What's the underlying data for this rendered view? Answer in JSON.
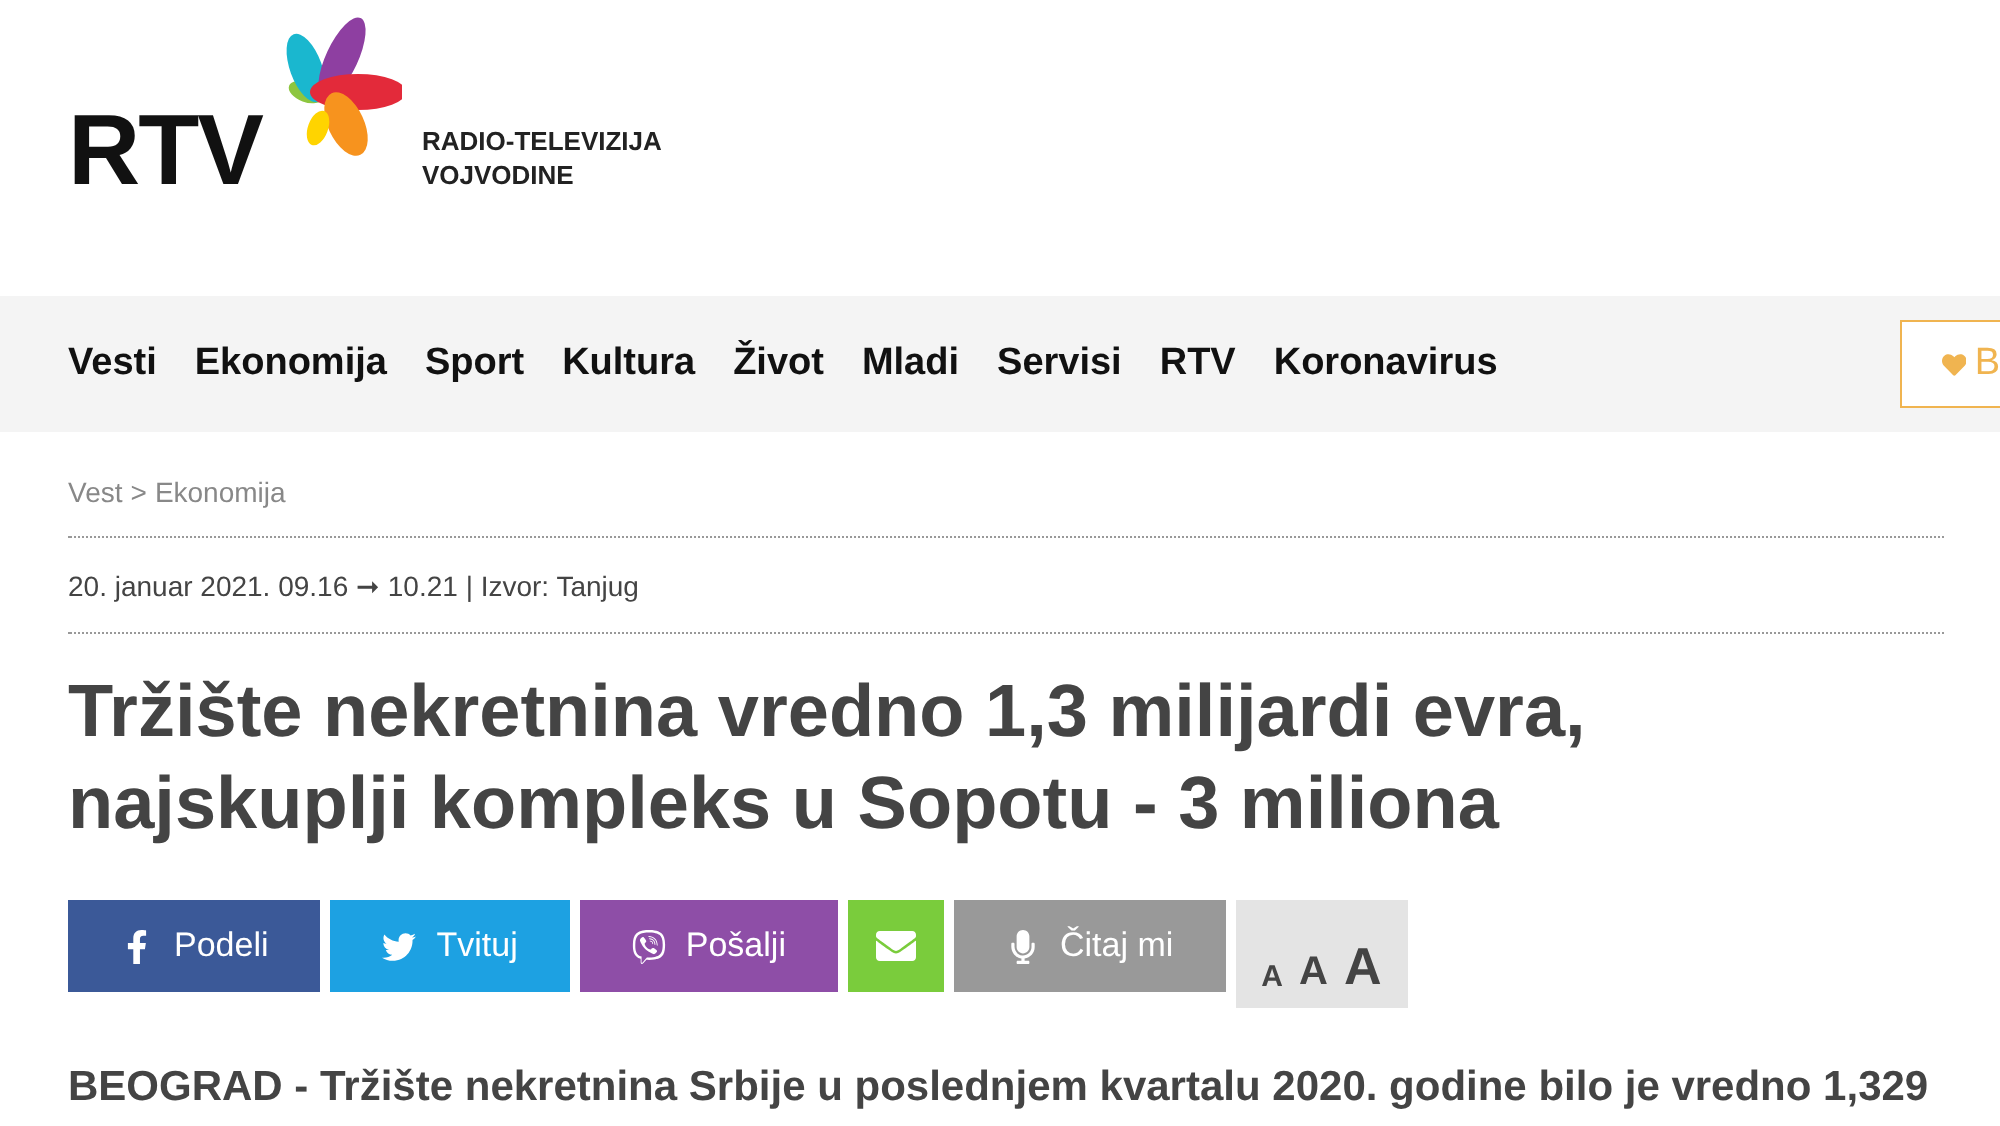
{
  "logo": {
    "letters": "RTV",
    "name_lines": [
      "RADIO-TELEVIZIJA",
      "VOJVODINE"
    ]
  },
  "nav": {
    "items": [
      "Vesti",
      "Ekonomija",
      "Sport",
      "Kultura",
      "Život",
      "Mladi",
      "Servisi",
      "RTV",
      "Koronavirus"
    ],
    "side_button": "B"
  },
  "breadcrumb": [
    {
      "label": "Vest"
    },
    {
      "label": "Ekonomija"
    }
  ],
  "breadcrumb_separator": ">",
  "meta": "20. januar 2021. 09.16 ➞ 10.21 | Izvor: Tanjug",
  "title": "Tržište nekretnina vredno 1,3 milijardi evra, najskuplji kompleks u Sopotu - 3 miliona",
  "share_buttons": [
    {
      "kind": "facebook",
      "label": "Podeli",
      "color": "#3b5998"
    },
    {
      "kind": "twitter",
      "label": "Tvituj",
      "color": "#1da1e2"
    },
    {
      "kind": "viber",
      "label": "Pošalji",
      "color": "#8e4ea7"
    },
    {
      "kind": "email",
      "color": "#7acc3c"
    },
    {
      "kind": "listen",
      "label": "Čitaj mi",
      "color": "#999999"
    }
  ],
  "font_sizes": [
    "A",
    "A",
    "A"
  ],
  "lead": "BEOGRAD - Tržište nekretnina Srbije u poslednjem kvartalu 2020. godine bilo je vredno 1,329"
}
